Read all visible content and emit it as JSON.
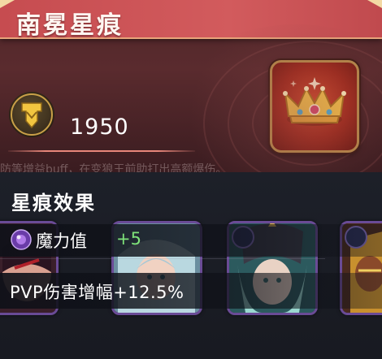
{
  "header": {
    "title": "南冕星痕"
  },
  "summary": {
    "score": "1950",
    "medal_icon": "shield-medal-icon",
    "crown_icon": "crown-icon",
    "faded_text": "防等增益buff，在变狼王前助打出高额爆伤。"
  },
  "effects": {
    "section_title": "星痕效果",
    "stat_icon": "magic-orb-icon",
    "stat_label": "魔力值",
    "stat_value": "+5",
    "pvp_text": "PVP伤害增幅+12.5%"
  },
  "colors": {
    "banner": "#d25b5d",
    "stat_positive": "#7fe37a",
    "card_border": "#6a4b96"
  }
}
